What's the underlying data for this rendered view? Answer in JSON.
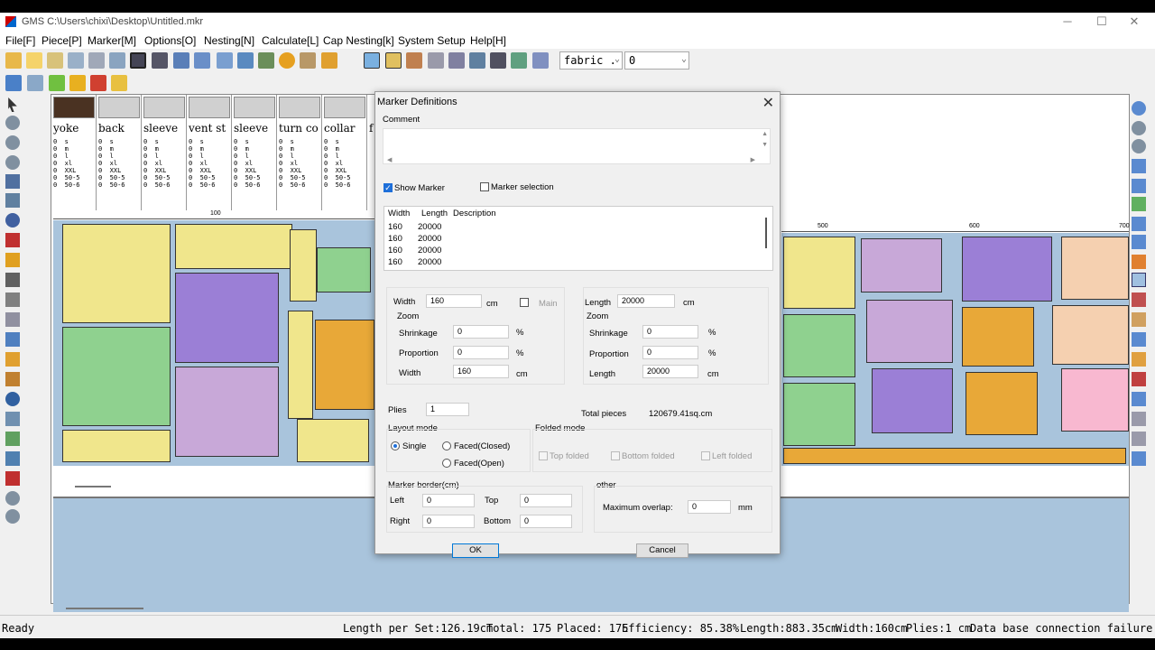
{
  "window": {
    "title": "GMS C:\\Users\\chixi\\Desktop\\Untitled.mkr",
    "minimize": "─",
    "maximize": "☐",
    "close": "✕"
  },
  "menu": [
    "File[F]",
    "Piece[P]",
    "Marker[M]",
    "Options[O]",
    "Nesting[N]",
    "Calculate[L]",
    "Cap Nesting[k]",
    "System Setup",
    "Help[H]"
  ],
  "toolbar": {
    "fabric_combo": "fabric .",
    "fabric_index": "0"
  },
  "pieces": [
    {
      "name": "yoke",
      "sizes": "0  s\n0  m\n0  l\n0  xl\n0  XXL\n0  50-5\n0  50-6"
    },
    {
      "name": "back",
      "sizes": "0  s\n0  m\n0  l\n0  xl\n0  XXL\n0  50-5\n0  50-6"
    },
    {
      "name": "sleeve",
      "sizes": "0  s\n0  m\n0  l\n0  xl\n0  XXL\n0  50-5\n0  50-6"
    },
    {
      "name": "vent st",
      "sizes": "0  s\n0  m\n0  l\n0  xl\n0  XXL\n0  50-5\n0  50-6"
    },
    {
      "name": "sleeve",
      "sizes": "0  s\n0  m\n0  l\n0  xl\n0  XXL\n0  50-5\n0  50-6"
    },
    {
      "name": "turn co",
      "sizes": "0  s\n0  m\n0  l\n0  xl\n0  XXL\n0  50-5\n0  50-6"
    },
    {
      "name": "collar",
      "sizes": "0  s\n0  m\n0  l\n0  xl\n0  XXL\n0  50-5\n0  50-6"
    },
    {
      "name": "f",
      "sizes": ""
    }
  ],
  "ruler": {
    "left_marks": [
      "100"
    ],
    "right_marks": [
      "500",
      "600",
      "700"
    ]
  },
  "dialog": {
    "title": "Marker Definitions",
    "comment_label": "Comment",
    "show_marker": "Show Marker",
    "marker_selection": "Marker selection",
    "table": {
      "headers": [
        "Width",
        "Length",
        "Description"
      ],
      "rows": [
        [
          "160",
          "20000",
          ""
        ],
        [
          "160",
          "20000",
          ""
        ],
        [
          "160",
          "20000",
          ""
        ],
        [
          "160",
          "20000",
          ""
        ]
      ]
    },
    "width_label": "Width",
    "width_value": "160",
    "width_unit": "cm",
    "main_label": "Main",
    "length_label": "Length",
    "length_value": "20000",
    "length_unit": "cm",
    "zoom_label": "Zoom",
    "left_zoom": {
      "shrinkage_label": "Shrinkage",
      "shrinkage": "0",
      "pct1": "%",
      "proportion_label": "Proportion",
      "proportion": "0",
      "pct2": "%",
      "width_label": "Width",
      "width": "160",
      "unit": "cm"
    },
    "right_zoom": {
      "shrinkage_label": "Shrinkage",
      "shrinkage": "0",
      "pct1": "%",
      "proportion_label": "Proportion",
      "proportion": "0",
      "pct2": "%",
      "length_label": "Length",
      "length": "20000",
      "unit": "cm"
    },
    "plies_label": "Plies",
    "plies": "1",
    "total_pieces_label": "Total pieces",
    "total_area": "120679.41sq.cm",
    "layout_mode_label": "Layout mode",
    "single": "Single",
    "faced_closed": "Faced(Closed)",
    "faced_open": "Faced(Open)",
    "folded_mode_label": "Folded mode",
    "top_folded": "Top folded",
    "bottom_folded": "Bottom folded",
    "left_folded": "Left folded",
    "border_label": "Marker border(cm)",
    "left_label": "Left",
    "left": "0",
    "top_label": "Top",
    "top": "0",
    "right_label": "Right",
    "right": "0",
    "bottom_label": "Bottom",
    "bottom": "0",
    "other_label": "other",
    "max_overlap_label": "Maximum overlap:",
    "max_overlap": "0",
    "mm": "mm",
    "ok": "OK",
    "cancel": "Cancel"
  },
  "status": {
    "ready": "Ready",
    "length_per_set": "Length per Set:126.19cm",
    "total": "Total: 175",
    "placed": "Placed: 175",
    "efficiency": "Efficiency: 85.38%",
    "length": "Length:883.35cm",
    "width": "Width:160cm",
    "plies": "Plies:1 cm",
    "db": "Data base connection failure"
  },
  "colors": {
    "yellow": "#f0e68c",
    "purple": "#9b7fd6",
    "green": "#8fd18f",
    "pink": "#d9a6c9",
    "orange": "#e8a838",
    "lavender": "#c8a8d8",
    "marker_bg": "#a9c4dc"
  }
}
